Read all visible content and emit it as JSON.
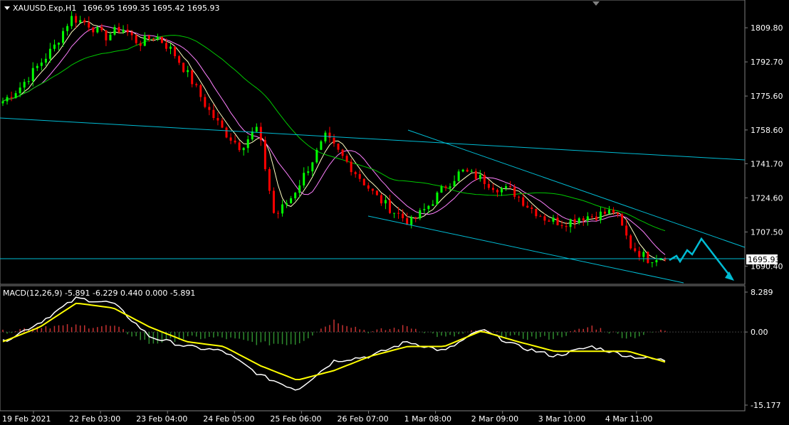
{
  "main_chart": {
    "symbol_label": "XAUUSD.Exp,H1",
    "ohlc_text": "1696.95 1699.35 1695.42 1695.93",
    "price_ticks": [
      "1809.80",
      "1792.70",
      "1775.60",
      "1758.60",
      "1741.70",
      "1724.60",
      "1707.50",
      "1690.40"
    ],
    "current_price": "1695.93"
  },
  "macd": {
    "header": "MACD(12,26,9) -5.891 -6.229 0.440 0.000 -5.891",
    "ticks": [
      "8.289",
      "0.00",
      "-15.177"
    ]
  },
  "time_axis": {
    "labels": [
      "19 Feb 2021",
      "22 Feb 03:00",
      "23 Feb 04:00",
      "24 Feb 05:00",
      "25 Feb 06:00",
      "26 Feb 07:00",
      "1 Mar 08:00",
      "2 Mar 09:00",
      "3 Mar 10:00",
      "4 Mar 11:00"
    ]
  },
  "colors": {
    "background": "#000000",
    "bull_candle": "#00ff00",
    "bear_candle": "#ff0000",
    "ma_fast": "#ffffc0",
    "ma_mid": "#ff80ff",
    "ma_slow": "#00c800",
    "trendline": "#00bcd4",
    "macd_line": "#ffffff",
    "signal_line": "#ffff00",
    "hist_pos": "#c83232",
    "hist_neg": "#2e8b2e"
  },
  "chart_data": [
    {
      "type": "candlestick",
      "title": "XAUUSD.Exp,H1",
      "ylim": [
        1682.0,
        1823.0
      ],
      "x_labels": [
        "19 Feb 2021",
        "22 Feb 03:00",
        "23 Feb 04:00",
        "24 Feb 05:00",
        "25 Feb 06:00",
        "26 Feb 07:00",
        "1 Mar 08:00",
        "2 Mar 09:00",
        "3 Mar 10:00",
        "4 Mar 11:00"
      ],
      "close_path": [
        1773,
        1780,
        1790,
        1800,
        1815,
        1812,
        1805,
        1810,
        1802,
        1806,
        1798,
        1785,
        1770,
        1758,
        1750,
        1760,
        1715,
        1725,
        1740,
        1755,
        1745,
        1735,
        1725,
        1718,
        1712,
        1720,
        1730,
        1738,
        1735,
        1730,
        1728,
        1720,
        1714,
        1712,
        1715,
        1716,
        1718,
        1700,
        1694,
        1695.93
      ]
    },
    {
      "type": "line",
      "title": "MACD(12,26,9)",
      "ylim": [
        -15.177,
        8.289
      ],
      "macd": [
        -2,
        2,
        7,
        6,
        -1,
        -3,
        -4,
        -9,
        -12,
        -6,
        -5,
        -2,
        -4,
        0.5,
        -3,
        -5,
        -3,
        -5,
        -5.891
      ],
      "signal": [
        -2,
        1,
        6,
        5,
        1,
        -2,
        -3,
        -7,
        -10,
        -8,
        -5,
        -3,
        -3,
        0.2,
        -2,
        -4,
        -4,
        -4,
        -6.229
      ]
    }
  ]
}
